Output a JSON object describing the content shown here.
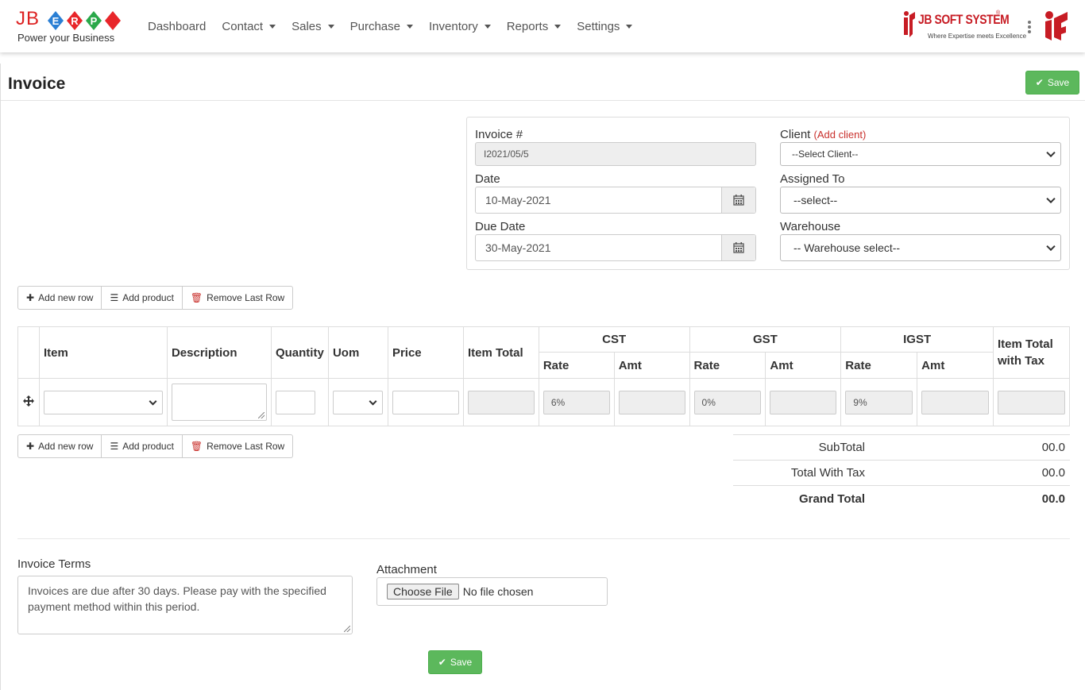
{
  "app": {
    "logo_text": "JB",
    "logo_letters": [
      "E",
      "R",
      "P"
    ],
    "logo_tagline": "Power your Business",
    "brand_name": "JB SOFT SYSTEM",
    "brand_tm": "®",
    "brand_tagline": "Where Expertise meets Excellence"
  },
  "nav": {
    "items": [
      {
        "label": "Dashboard",
        "dropdown": false
      },
      {
        "label": "Contact",
        "dropdown": true
      },
      {
        "label": "Sales",
        "dropdown": true
      },
      {
        "label": "Purchase",
        "dropdown": true
      },
      {
        "label": "Inventory",
        "dropdown": true
      },
      {
        "label": "Reports",
        "dropdown": true
      },
      {
        "label": "Settings",
        "dropdown": true
      }
    ]
  },
  "page": {
    "title": "Invoice",
    "save_label": "Save"
  },
  "form": {
    "invoice_label": "Invoice #",
    "invoice_value": "I2021/05/5",
    "date_label": "Date",
    "date_value": "10-May-2021",
    "due_label": "Due Date",
    "due_value": "30-May-2021",
    "client_label": "Client",
    "add_client_open": "(",
    "add_client": "Add client",
    "add_client_close": ")",
    "client_value": "--Select Client--",
    "assigned_label": "Assigned To",
    "assigned_value": "--select--",
    "warehouse_label": "Warehouse",
    "warehouse_value": "-- Warehouse select--"
  },
  "toolbar": {
    "add_row": "Add new row",
    "add_product": "Add product",
    "remove_row": "Remove Last Row"
  },
  "table": {
    "headers": {
      "item": "Item",
      "description": "Description",
      "quantity": "Quantity",
      "uom": "Uom",
      "price": "Price",
      "item_total": "Item Total",
      "cst": "CST",
      "gst": "GST",
      "igst": "IGST",
      "rate": "Rate",
      "amt": "Amt",
      "item_total_tax": "Item Total with Tax"
    },
    "row": {
      "cst_rate": "6%",
      "gst_rate": "0%",
      "igst_rate": "9%"
    }
  },
  "totals": {
    "subtotal_label": "SubTotal",
    "subtotal_value": "00.0",
    "total_tax_label": "Total With Tax",
    "total_tax_value": "00.0",
    "grand_label": "Grand Total",
    "grand_value": "00.0"
  },
  "terms": {
    "label": "Invoice Terms",
    "text": "Invoices are due after 30 days. Please pay with the specified payment method within this period."
  },
  "attachment": {
    "label": "Attachment",
    "button": "Choose File",
    "status": "No file chosen"
  },
  "colors": {
    "brand_red": "#c71c24",
    "save_green": "#5cb85c",
    "link_red": "#c9302c"
  }
}
